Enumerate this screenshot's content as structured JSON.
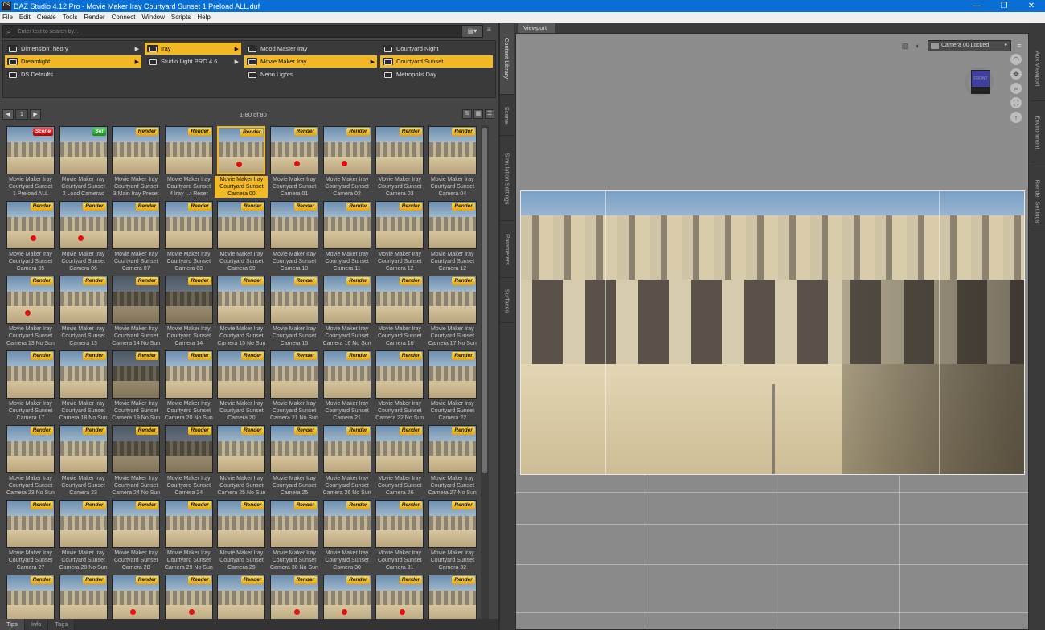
{
  "window": {
    "title": "DAZ Studio 4.12 Pro - Movie Maker Iray Courtyard Sunset 1 Preload ALL.duf",
    "app_icon": "DS",
    "minimize": "—",
    "maximize": "❐",
    "close": "✕"
  },
  "menu": [
    "File",
    "Edit",
    "Create",
    "Tools",
    "Render",
    "Connect",
    "Window",
    "Scripts",
    "Help"
  ],
  "search": {
    "placeholder": "Enter text to search by..."
  },
  "browser": {
    "col1": [
      {
        "label": "DimensionTheory",
        "selected": false,
        "arrow": "▶"
      },
      {
        "label": "Dreamlight",
        "selected": true,
        "arrow": "▶"
      },
      {
        "label": "DS Defaults",
        "selected": false,
        "arrow": ""
      }
    ],
    "col2": [
      {
        "label": "Iray",
        "selected": true,
        "arrow": "▶"
      },
      {
        "label": "Studio Light PRO 4.6",
        "selected": false,
        "arrow": "▶"
      }
    ],
    "col3": [
      {
        "label": "Mood Master Iray",
        "selected": false,
        "arrow": ""
      },
      {
        "label": "Movie Maker Iray",
        "selected": true,
        "arrow": "▶"
      },
      {
        "label": "Neon Lights",
        "selected": false,
        "arrow": ""
      }
    ],
    "col4": [
      {
        "label": "Courtyard Night",
        "selected": false,
        "arrow": ""
      },
      {
        "label": "Courtyard Sunset",
        "selected": true,
        "arrow": ""
      },
      {
        "label": "Metropolis Day",
        "selected": false,
        "arrow": ""
      }
    ]
  },
  "pager": {
    "page": "1",
    "prev": "◀",
    "next": "▶",
    "count": "1-80 of 80"
  },
  "tiles": [
    {
      "l1": "Movie Maker Iray",
      "l2": "Courtyard Sunset",
      "l3": "1 Preload ALL",
      "badge": "Scene",
      "kind": "scene",
      "dot": false,
      "dark": false
    },
    {
      "l1": "Movie Maker Iray",
      "l2": "Courtyard Sunset",
      "l3": "2 Load Cameras",
      "badge": "Set",
      "kind": "set",
      "dot": false,
      "dark": false
    },
    {
      "l1": "Movie Maker Iray",
      "l2": "Courtyard Sunset",
      "l3": "3 Main Iray Preset",
      "badge": "Render",
      "kind": "render",
      "dot": false,
      "dark": false
    },
    {
      "l1": "Movie Maker Iray",
      "l2": "Courtyard Sunset",
      "l3": "4 Iray ...t Reset",
      "badge": "Render",
      "kind": "render",
      "dot": false,
      "dark": false
    },
    {
      "l1": "Movie Maker Iray",
      "l2": "Courtyard Sunset",
      "l3": "Camera 00",
      "badge": "Render",
      "kind": "render",
      "dot": true,
      "dark": false,
      "selected": true
    },
    {
      "l1": "Movie Maker Iray",
      "l2": "Courtyard Sunset",
      "l3": "Camera 01",
      "badge": "Render",
      "kind": "render",
      "dot": true,
      "dark": false
    },
    {
      "l1": "Movie Maker Iray",
      "l2": "Courtyard Sunset",
      "l3": "Camera 02",
      "badge": "Render",
      "kind": "render",
      "dot": true,
      "dark": false
    },
    {
      "l1": "Movie Maker Iray",
      "l2": "Courtyard Sunset",
      "l3": "Camera 03",
      "badge": "Render",
      "kind": "render",
      "dot": false,
      "dark": false
    },
    {
      "l1": "Movie Maker Iray",
      "l2": "Courtyard Sunset",
      "l3": "Camera 04",
      "badge": "Render",
      "kind": "render",
      "dot": false,
      "dark": false
    },
    {
      "l1": "Movie Maker Iray",
      "l2": "Courtyard Sunset",
      "l3": "Camera 05",
      "badge": "Render",
      "kind": "render",
      "dot": true,
      "dark": false
    },
    {
      "l1": "Movie Maker Iray",
      "l2": "Courtyard Sunset",
      "l3": "Camera 06",
      "badge": "Render",
      "kind": "render",
      "dot": true,
      "dark": false
    },
    {
      "l1": "Movie Maker Iray",
      "l2": "Courtyard Sunset",
      "l3": "Camera 07",
      "badge": "Render",
      "kind": "render",
      "dot": false,
      "dark": false
    },
    {
      "l1": "Movie Maker Iray",
      "l2": "Courtyard Sunset",
      "l3": "Camera 08",
      "badge": "Render",
      "kind": "render",
      "dot": false,
      "dark": false
    },
    {
      "l1": "Movie Maker Iray",
      "l2": "Courtyard Sunset",
      "l3": "Camera 09",
      "badge": "Render",
      "kind": "render",
      "dot": false,
      "dark": false
    },
    {
      "l1": "Movie Maker Iray",
      "l2": "Courtyard Sunset",
      "l3": "Camera 10",
      "badge": "Render",
      "kind": "render",
      "dot": false,
      "dark": false
    },
    {
      "l1": "Movie Maker Iray",
      "l2": "Courtyard Sunset",
      "l3": "Camera 11",
      "badge": "Render",
      "kind": "render",
      "dot": false,
      "dark": false
    },
    {
      "l1": "Movie Maker Iray",
      "l2": "Courtyard Sunset",
      "l3": "Camera 12",
      "badge": "Render",
      "kind": "render",
      "dot": false,
      "dark": false
    },
    {
      "l1": "Movie Maker Iray",
      "l2": "Courtyard Sunset",
      "l3": "Camera 12",
      "badge": "Render",
      "kind": "render",
      "dot": false,
      "dark": false
    },
    {
      "l1": "Movie Maker Iray",
      "l2": "Courtyard Sunset",
      "l3": "Camera 13 No Sun",
      "badge": "Render",
      "kind": "render",
      "dot": true,
      "dark": false
    },
    {
      "l1": "Movie Maker Iray",
      "l2": "Courtyard Sunset",
      "l3": "Camera 13",
      "badge": "Render",
      "kind": "render",
      "dot": false,
      "dark": false
    },
    {
      "l1": "Movie Maker Iray",
      "l2": "Courtyard Sunset",
      "l3": "Camera 14 No Sun",
      "badge": "Render",
      "kind": "render",
      "dot": false,
      "dark": true
    },
    {
      "l1": "Movie Maker Iray",
      "l2": "Courtyard Sunset",
      "l3": "Camera 14",
      "badge": "Render",
      "kind": "render",
      "dot": false,
      "dark": true
    },
    {
      "l1": "Movie Maker Iray",
      "l2": "Courtyard Sunset",
      "l3": "Camera 15 No Sun",
      "badge": "Render",
      "kind": "render",
      "dot": false,
      "dark": false
    },
    {
      "l1": "Movie Maker Iray",
      "l2": "Courtyard Sunset",
      "l3": "Camera 15",
      "badge": "Render",
      "kind": "render",
      "dot": false,
      "dark": false
    },
    {
      "l1": "Movie Maker Iray",
      "l2": "Courtyard Sunset",
      "l3": "Camera 16 No Sun",
      "badge": "Render",
      "kind": "render",
      "dot": false,
      "dark": false
    },
    {
      "l1": "Movie Maker Iray",
      "l2": "Courtyard Sunset",
      "l3": "Camera 16",
      "badge": "Render",
      "kind": "render",
      "dot": false,
      "dark": false
    },
    {
      "l1": "Movie Maker Iray",
      "l2": "Courtyard Sunset",
      "l3": "Camera 17 No Sun",
      "badge": "Render",
      "kind": "render",
      "dot": false,
      "dark": false
    },
    {
      "l1": "Movie Maker Iray",
      "l2": "Courtyard Sunset",
      "l3": "Camera 17",
      "badge": "Render",
      "kind": "render",
      "dot": false,
      "dark": false
    },
    {
      "l1": "Movie Maker Iray",
      "l2": "Courtyard Sunset",
      "l3": "Camera 18 No Sun",
      "badge": "Render",
      "kind": "render",
      "dot": false,
      "dark": false
    },
    {
      "l1": "Movie Maker Iray",
      "l2": "Courtyard Sunset",
      "l3": "Camera 19 No Sun",
      "badge": "Render",
      "kind": "render",
      "dot": false,
      "dark": true
    },
    {
      "l1": "Movie Maker Iray",
      "l2": "Courtyard Sunset",
      "l3": "Camera 20 No Sun",
      "badge": "Render",
      "kind": "render",
      "dot": false,
      "dark": false
    },
    {
      "l1": "Movie Maker Iray",
      "l2": "Courtyard Sunset",
      "l3": "Camera 20",
      "badge": "Render",
      "kind": "render",
      "dot": false,
      "dark": false
    },
    {
      "l1": "Movie Maker Iray",
      "l2": "Courtyard Sunset",
      "l3": "Camera 21 No Sun",
      "badge": "Render",
      "kind": "render",
      "dot": false,
      "dark": false
    },
    {
      "l1": "Movie Maker Iray",
      "l2": "Courtyard Sunset",
      "l3": "Camera 21",
      "badge": "Render",
      "kind": "render",
      "dot": false,
      "dark": false
    },
    {
      "l1": "Movie Maker Iray",
      "l2": "Courtyard Sunset",
      "l3": "Camera 22 No Sun",
      "badge": "Render",
      "kind": "render",
      "dot": false,
      "dark": false
    },
    {
      "l1": "Movie Maker Iray",
      "l2": "Courtyard Sunset",
      "l3": "Camera 22",
      "badge": "Render",
      "kind": "render",
      "dot": false,
      "dark": false
    },
    {
      "l1": "Movie Maker Iray",
      "l2": "Courtyard Sunset",
      "l3": "Camera 23 No Sun",
      "badge": "Render",
      "kind": "render",
      "dot": false,
      "dark": false
    },
    {
      "l1": "Movie Maker Iray",
      "l2": "Courtyard Sunset",
      "l3": "Camera 23",
      "badge": "Render",
      "kind": "render",
      "dot": false,
      "dark": false
    },
    {
      "l1": "Movie Maker Iray",
      "l2": "Courtyard Sunset",
      "l3": "Camera 24 No Sun",
      "badge": "Render",
      "kind": "render",
      "dot": false,
      "dark": true
    },
    {
      "l1": "Movie Maker Iray",
      "l2": "Courtyard Sunset",
      "l3": "Camera 24",
      "badge": "Render",
      "kind": "render",
      "dot": false,
      "dark": true
    },
    {
      "l1": "Movie Maker Iray",
      "l2": "Courtyard Sunset",
      "l3": "Camera 25 No Sun",
      "badge": "Render",
      "kind": "render",
      "dot": false,
      "dark": false
    },
    {
      "l1": "Movie Maker Iray",
      "l2": "Courtyard Sunset",
      "l3": "Camera 25",
      "badge": "Render",
      "kind": "render",
      "dot": false,
      "dark": false
    },
    {
      "l1": "Movie Maker Iray",
      "l2": "Courtyard Sunset",
      "l3": "Camera 26 No Sun",
      "badge": "Render",
      "kind": "render",
      "dot": false,
      "dark": false
    },
    {
      "l1": "Movie Maker Iray",
      "l2": "Courtyard Sunset",
      "l3": "Camera 26",
      "badge": "Render",
      "kind": "render",
      "dot": false,
      "dark": false
    },
    {
      "l1": "Movie Maker Iray",
      "l2": "Courtyard Sunset",
      "l3": "Camera 27 No Sun",
      "badge": "Render",
      "kind": "render",
      "dot": false,
      "dark": false
    },
    {
      "l1": "Movie Maker Iray",
      "l2": "Courtyard Sunset",
      "l3": "Camera 27",
      "badge": "Render",
      "kind": "render",
      "dot": false,
      "dark": false
    },
    {
      "l1": "Movie Maker Iray",
      "l2": "Courtyard Sunset",
      "l3": "Camera 28 No Sun",
      "badge": "Render",
      "kind": "render",
      "dot": false,
      "dark": false
    },
    {
      "l1": "Movie Maker Iray",
      "l2": "Courtyard Sunset",
      "l3": "Camera 28",
      "badge": "Render",
      "kind": "render",
      "dot": false,
      "dark": false
    },
    {
      "l1": "Movie Maker Iray",
      "l2": "Courtyard Sunset",
      "l3": "Camera 29 No Sun",
      "badge": "Render",
      "kind": "render",
      "dot": false,
      "dark": false
    },
    {
      "l1": "Movie Maker Iray",
      "l2": "Courtyard Sunset",
      "l3": "Camera 29",
      "badge": "Render",
      "kind": "render",
      "dot": false,
      "dark": false
    },
    {
      "l1": "Movie Maker Iray",
      "l2": "Courtyard Sunset",
      "l3": "Camera 30 No Sun",
      "badge": "Render",
      "kind": "render",
      "dot": false,
      "dark": false
    },
    {
      "l1": "Movie Maker Iray",
      "l2": "Courtyard Sunset",
      "l3": "Camera 30",
      "badge": "Render",
      "kind": "render",
      "dot": false,
      "dark": false
    },
    {
      "l1": "Movie Maker Iray",
      "l2": "Courtyard Sunset",
      "l3": "Camera 31",
      "badge": "Render",
      "kind": "render",
      "dot": false,
      "dark": false
    },
    {
      "l1": "Movie Maker Iray",
      "l2": "Courtyard Sunset",
      "l3": "Camera 32",
      "badge": "Render",
      "kind": "render",
      "dot": false,
      "dark": false
    },
    {
      "l1": "",
      "l2": "",
      "l3": "",
      "badge": "Render",
      "kind": "render",
      "dot": false,
      "dark": false
    },
    {
      "l1": "",
      "l2": "",
      "l3": "",
      "badge": "Render",
      "kind": "render",
      "dot": false,
      "dark": false
    },
    {
      "l1": "",
      "l2": "",
      "l3": "",
      "badge": "Render",
      "kind": "render",
      "dot": true,
      "dark": false
    },
    {
      "l1": "",
      "l2": "",
      "l3": "",
      "badge": "Render",
      "kind": "render",
      "dot": true,
      "dark": false
    },
    {
      "l1": "",
      "l2": "",
      "l3": "",
      "badge": "Render",
      "kind": "render",
      "dot": false,
      "dark": false
    },
    {
      "l1": "",
      "l2": "",
      "l3": "",
      "badge": "Render",
      "kind": "render",
      "dot": true,
      "dark": false
    },
    {
      "l1": "",
      "l2": "",
      "l3": "",
      "badge": "Render",
      "kind": "render",
      "dot": true,
      "dark": false
    },
    {
      "l1": "",
      "l2": "",
      "l3": "",
      "badge": "Render",
      "kind": "render",
      "dot": true,
      "dark": false
    },
    {
      "l1": "",
      "l2": "",
      "l3": "",
      "badge": "Render",
      "kind": "render",
      "dot": false,
      "dark": false
    }
  ],
  "bottom_tabs": [
    "Tips",
    "Info",
    "Tags"
  ],
  "left_side_tabs": [
    "Content Library",
    "Scene",
    "Simulation Settings",
    "Parameters",
    "Surfaces"
  ],
  "right_side_tabs": [
    "Aux Viewport",
    "Environment",
    "Render Settings"
  ],
  "viewport": {
    "tab": "Viewport",
    "camera": "Camera 00 Locked",
    "cube_label": "FRONT"
  },
  "colors": {
    "accent": "#f2b924",
    "titlebar": "#0a6fd4"
  }
}
